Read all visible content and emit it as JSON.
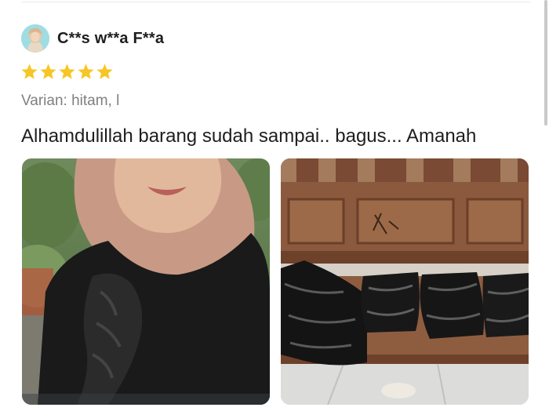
{
  "review": {
    "reviewer_name": "C**s w**a F**a",
    "rating": 5,
    "rating_max": 5,
    "variant": "Varian: hitam, l",
    "text": "Alhamdulillah barang sudah sampai.. bagus... Amanah",
    "photo_count": 2,
    "star_color": "#f7c625"
  },
  "icons": {
    "avatar": "user-avatar-icon",
    "star": "star-icon"
  }
}
